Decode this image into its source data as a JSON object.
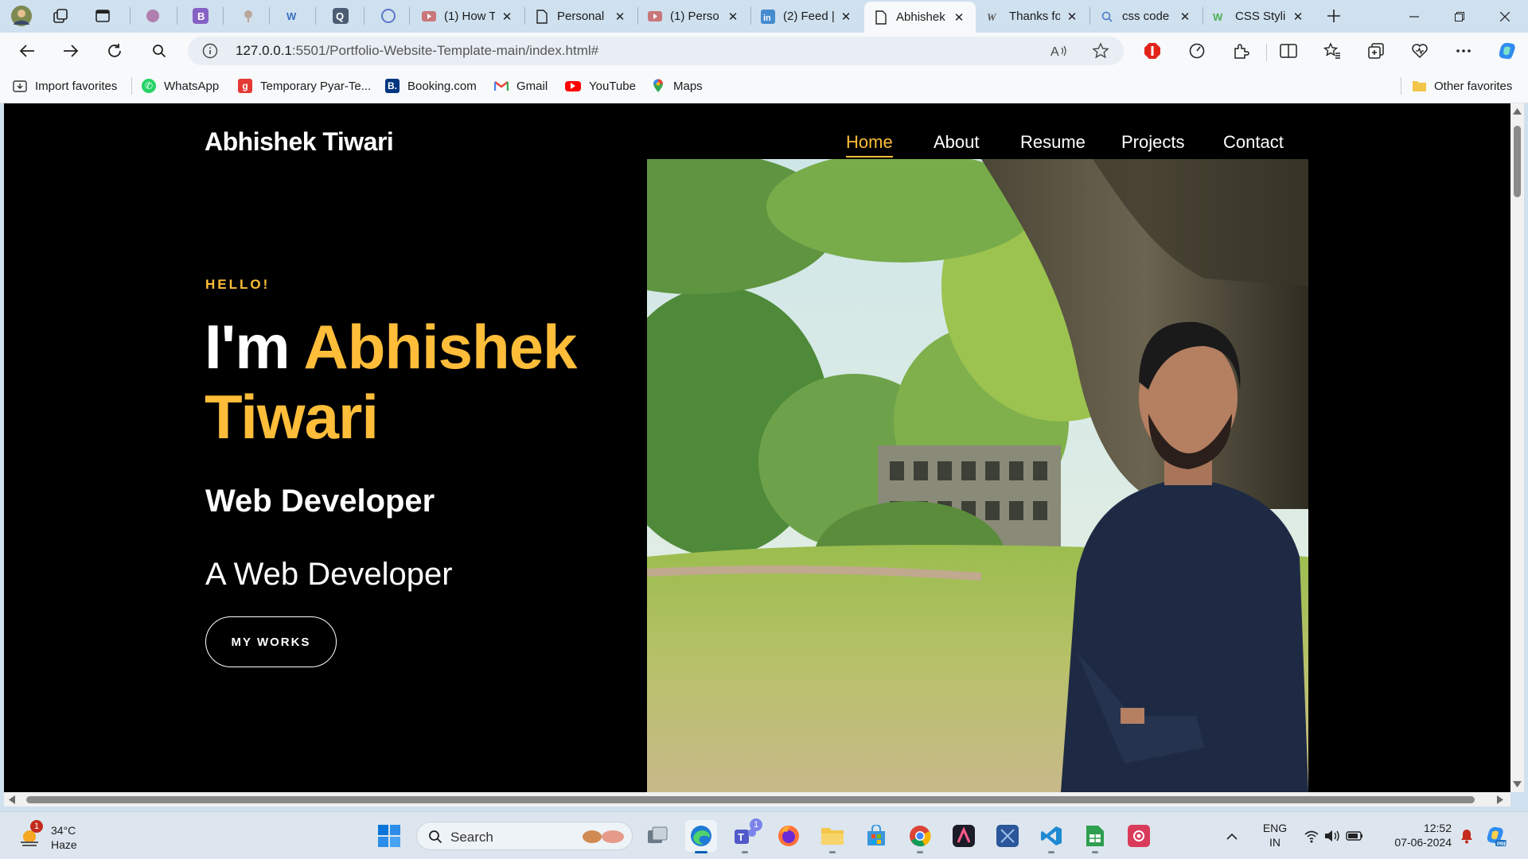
{
  "browser": {
    "tabs": [
      {
        "title": "(1) How T",
        "icon": "youtube-icon"
      },
      {
        "title": "Personal",
        "icon": "page-icon"
      },
      {
        "title": "(1) Perso",
        "icon": "youtube-icon"
      },
      {
        "title": "(2) Feed |",
        "icon": "linkedin-icon"
      },
      {
        "title": "Abhishek",
        "icon": "page-icon",
        "active": true
      },
      {
        "title": "Thanks fo",
        "icon": "w-logo-icon"
      },
      {
        "title": "css code",
        "icon": "search-icon"
      },
      {
        "title": "CSS Stylin",
        "icon": "w3-icon"
      }
    ],
    "address": {
      "host": "127.0.0.1",
      "path": ":5501/Portfolio-Website-Template-main/index.html#"
    },
    "favorites": [
      {
        "label": "Import favorites",
        "icon": "import-icon"
      },
      {
        "label": "WhatsApp",
        "icon": "whatsapp-icon",
        "color": "#25d366"
      },
      {
        "label": "Temporary Pyar-Te...",
        "icon": "g-logo-icon",
        "color": "#e53935"
      },
      {
        "label": "Booking.com",
        "icon": "booking-icon",
        "color": "#003580"
      },
      {
        "label": "Gmail",
        "icon": "gmail-icon"
      },
      {
        "label": "YouTube",
        "icon": "youtube-icon",
        "color": "#ff0000"
      },
      {
        "label": "Maps",
        "icon": "maps-pin-icon"
      }
    ],
    "other_favorites": "Other favorites"
  },
  "site": {
    "brand": "Abhishek Tiwari",
    "nav": [
      "Home",
      "About",
      "Resume",
      "Projects",
      "Contact"
    ],
    "active_nav": "Home",
    "accent": "#ffbd39",
    "hello": "HELLO!",
    "heading_prefix": "I'm",
    "heading_name": "Abhishek Tiwari",
    "role": "Web Developer",
    "typed": "A Web Developer",
    "cta": "MY WORKS"
  },
  "taskbar": {
    "weather_temp": "34°C",
    "weather_desc": "Haze",
    "weather_badge": "1",
    "search_placeholder": "Search",
    "teams_badge": "1",
    "lang": "ENG",
    "region": "IN",
    "time": "12:52",
    "date": "07-06-2024"
  }
}
